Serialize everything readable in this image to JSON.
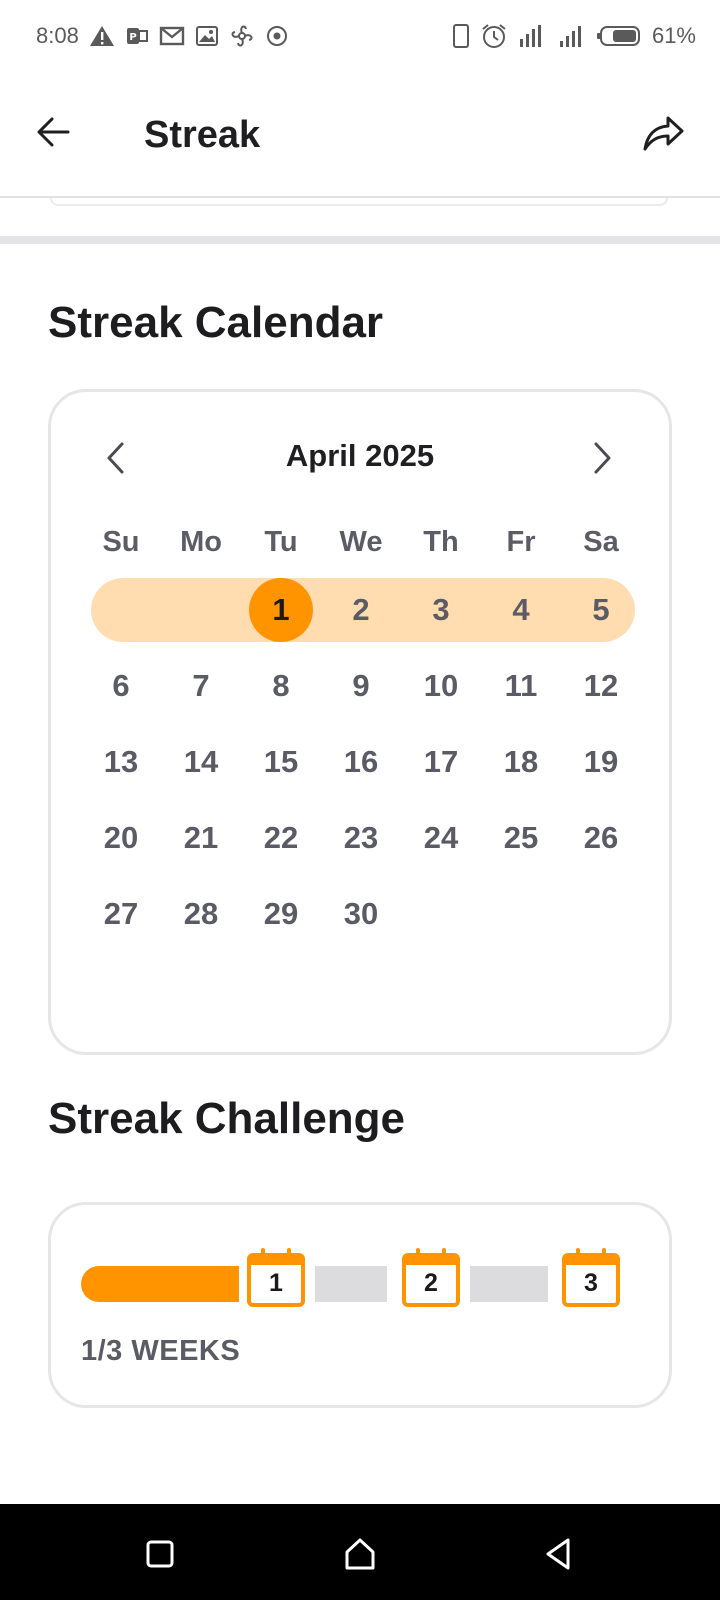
{
  "status_bar": {
    "time": "8:08",
    "battery": "61%",
    "left_icons": [
      "warning-icon",
      "outlook-icon",
      "mail-icon",
      "image-icon",
      "fan-icon",
      "target-icon"
    ],
    "right_icons": [
      "phone-icon",
      "alarm-icon",
      "wifi-signal-icon",
      "cell-signal-icon",
      "battery-icon"
    ]
  },
  "app_bar": {
    "title": "Streak",
    "back_icon": "arrow-left-icon",
    "share_icon": "share-icon"
  },
  "calendar_section": {
    "title": "Streak Calendar",
    "month": "April 2025",
    "weekdays": [
      "Su",
      "Mo",
      "Tu",
      "We",
      "Th",
      "Fr",
      "Sa"
    ],
    "weeks": [
      [
        "",
        "",
        "1",
        "2",
        "3",
        "4",
        "5"
      ],
      [
        "6",
        "7",
        "8",
        "9",
        "10",
        "11",
        "12"
      ],
      [
        "13",
        "14",
        "15",
        "16",
        "17",
        "18",
        "19"
      ],
      [
        "20",
        "21",
        "22",
        "23",
        "24",
        "25",
        "26"
      ],
      [
        "27",
        "28",
        "29",
        "30",
        "",
        "",
        ""
      ]
    ],
    "active_day": "1",
    "highlighted_week": 0,
    "colors": {
      "accent": "#ff9400",
      "week_highlight": "#ffddb0"
    }
  },
  "challenge_section": {
    "title": "Streak Challenge",
    "milestones": [
      "1",
      "2",
      "3"
    ],
    "completed_weeks": 1,
    "total_weeks": 3,
    "progress_label": "1/3 WEEKS"
  },
  "nav_bar": {
    "icons": [
      "recent-apps-icon",
      "home-icon",
      "back-icon"
    ]
  }
}
